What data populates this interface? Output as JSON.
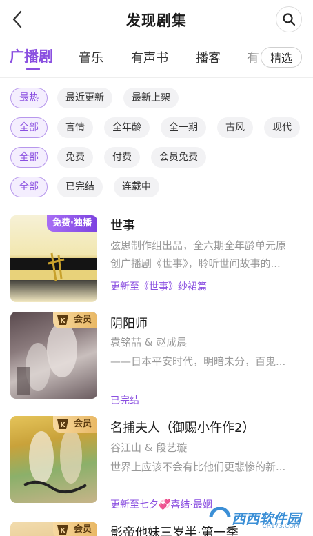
{
  "header": {
    "title": "发现剧集"
  },
  "tabs": [
    {
      "label": "广播剧",
      "active": true
    },
    {
      "label": "音乐"
    },
    {
      "label": "有声书"
    },
    {
      "label": "播客"
    },
    {
      "label": "有"
    }
  ],
  "featured_button": "精选",
  "filters": {
    "sort": [
      "最热",
      "最近更新",
      "最新上架"
    ],
    "genre": [
      "全部",
      "言情",
      "全年龄",
      "全一期",
      "古风",
      "现代"
    ],
    "price": [
      "全部",
      "免费",
      "付费",
      "会员免费"
    ],
    "status": [
      "全部",
      "已完结",
      "连载中"
    ]
  },
  "items": [
    {
      "title": "世事",
      "badge": "免费·独播",
      "lines": [
        "弦思制作组出品，全六期全年龄单元原",
        "创广播剧《世事》，聆听世间故事的..."
      ],
      "status": "更新至《世事》纱裙篇"
    },
    {
      "title": "阴阳师",
      "badge": "会员",
      "lines": [
        "袁铭喆 & 赵成晨",
        "——日本平安时代，明暗未分，百鬼..."
      ],
      "status": "已完结"
    },
    {
      "title": "名捕夫人（御赐小仵作2）",
      "badge": "会员",
      "lines": [
        "谷江山 & 段艺璇",
        "世界上应该不会有比他们更悲惨的新..."
      ],
      "status": "更新至七夕💞喜结·最姻"
    },
    {
      "title": "影帝他妹三岁半·第一季",
      "badge": "会员",
      "lines": [],
      "status": ""
    }
  ],
  "watermark": {
    "text": "西西软件园",
    "sub": "CR173.COM"
  },
  "colors": {
    "accent": "#8a4fe0",
    "vip_gold": "#e9b865"
  }
}
